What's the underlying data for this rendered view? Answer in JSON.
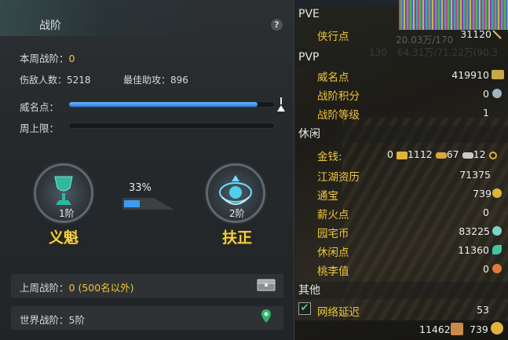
{
  "left": {
    "title": "战阶",
    "help": "?",
    "weekly_rank_label": "本周战阶：",
    "weekly_rank_value": "0",
    "kills_label": "伤敌人数：",
    "kills_value": "5218",
    "best_assist_label": "最佳助攻：",
    "best_assist_value": "896",
    "prestige_label": "威名点：",
    "prestige_progress": 0.92,
    "weekly_cap_label": "周上限：",
    "weekly_cap_progress": 0,
    "medal_left": {
      "tier": "1阶",
      "name": "义魁"
    },
    "medal_right": {
      "tier": "2阶",
      "name": "扶正"
    },
    "progress_percent": "33%",
    "progress_fraction": 0.33,
    "last_week_label": "上周战阶：",
    "last_week_value": "0 (500名以外)",
    "world_label": "世界战阶：",
    "world_value": "5阶"
  },
  "right": {
    "pve_label": "PVE",
    "chivalry_label": "侠行点",
    "chivalry_value": "31120",
    "bg_text_1": "20.03万/170",
    "bg_text_2": "130",
    "bg_text_3": "64.31万/71.22万(90.3",
    "pvp_label": "PVP",
    "prestige_label": "威名点",
    "prestige_value": "419910",
    "rank_points_label": "战阶积分",
    "rank_points_value": "0",
    "rank_level_label": "战阶等级",
    "rank_level_value": "1",
    "leisure_label": "休闲",
    "money_label": "金钱:",
    "money_zero": "0",
    "money_gold": "1112",
    "money_silver": "67",
    "money_copper": "12",
    "jianghu_label": "江湖资历",
    "jianghu_value": "71375",
    "tongbao_label": "通宝",
    "tongbao_value": "739",
    "firewood_label": "薪火点",
    "firewood_value": "0",
    "garden_label": "园宅币",
    "garden_value": "83225",
    "leisure_pts_label": "休闲点",
    "leisure_pts_value": "11360",
    "taoli_label": "桃李值",
    "taoli_value": "0",
    "other_label": "其他",
    "latency_label": "网络延迟",
    "latency_value": "53",
    "footer_left": "11462",
    "footer_right": "739",
    "colors": {
      "gold_text": "#f0c53a",
      "bar": "#2c7ed8",
      "check": "#4fd36b"
    }
  }
}
